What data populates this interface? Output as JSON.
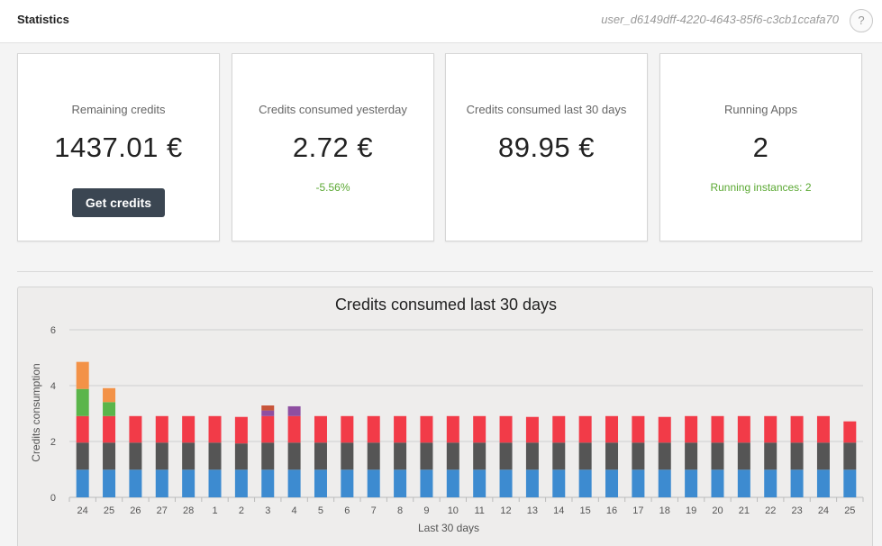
{
  "header": {
    "title": "Statistics",
    "user_id": "user_d6149dff-4220-4643-85f6-c3cb1ccafa70",
    "help_label": "?"
  },
  "cards": [
    {
      "label": "Remaining credits",
      "value": "1437.01 €",
      "button_label": "Get credits"
    },
    {
      "label": "Credits consumed yesterday",
      "value": "2.72 €",
      "sub": "-5.56%"
    },
    {
      "label": "Credits consumed last 30 days",
      "value": "89.95 €"
    },
    {
      "label": "Running Apps",
      "value": "2",
      "sub": "Running instances: 2"
    }
  ],
  "colors": {
    "accent_dark": "#3b4652",
    "positive": "#5aa832",
    "blue": "#3d8bd0",
    "gray": "#555555",
    "red": "#f23b48",
    "green": "#5ab54a",
    "orange": "#f39247",
    "purple": "#8e4fa1",
    "brown": "#c8553a"
  },
  "chart_data": {
    "type": "bar",
    "stacked": true,
    "title": "Credits consumed last 30 days",
    "xlabel": "Last 30 days",
    "ylabel": "Credits consumption",
    "ylim": [
      0,
      6
    ],
    "yticks": [
      0,
      2,
      4,
      6
    ],
    "grid": true,
    "categories": [
      "24",
      "25",
      "26",
      "27",
      "28",
      "1",
      "2",
      "3",
      "4",
      "5",
      "6",
      "7",
      "8",
      "9",
      "10",
      "11",
      "12",
      "13",
      "14",
      "15",
      "16",
      "17",
      "18",
      "19",
      "20",
      "21",
      "22",
      "23",
      "24",
      "25"
    ],
    "series": [
      {
        "color": "#3d8bd0",
        "values": [
          0.99,
          0.99,
          0.99,
          0.99,
          0.99,
          0.99,
          0.99,
          0.99,
          0.99,
          0.99,
          0.99,
          0.99,
          0.99,
          0.99,
          0.99,
          0.99,
          0.99,
          0.99,
          0.99,
          0.99,
          0.99,
          0.99,
          0.99,
          0.99,
          0.99,
          0.99,
          0.99,
          0.99,
          0.99,
          0.99
        ]
      },
      {
        "color": "#555555",
        "values": [
          0.97,
          0.97,
          0.97,
          0.97,
          0.97,
          0.97,
          0.94,
          0.97,
          0.97,
          0.97,
          0.97,
          0.97,
          0.97,
          0.97,
          0.97,
          0.97,
          0.97,
          0.97,
          0.97,
          0.97,
          0.97,
          0.97,
          0.97,
          0.97,
          0.97,
          0.97,
          0.97,
          0.97,
          0.97,
          0.97
        ]
      },
      {
        "color": "#f23b48",
        "values": [
          0.95,
          0.95,
          0.95,
          0.95,
          0.95,
          0.95,
          0.95,
          0.95,
          0.95,
          0.95,
          0.95,
          0.95,
          0.95,
          0.95,
          0.95,
          0.95,
          0.95,
          0.92,
          0.95,
          0.95,
          0.95,
          0.95,
          0.92,
          0.95,
          0.95,
          0.95,
          0.95,
          0.95,
          0.95,
          0.76
        ]
      },
      {
        "color": "#5ab54a",
        "values": [
          0.97,
          0.5,
          0,
          0,
          0,
          0,
          0,
          0,
          0,
          0,
          0,
          0,
          0,
          0,
          0,
          0,
          0,
          0,
          0,
          0,
          0,
          0,
          0,
          0,
          0,
          0,
          0,
          0,
          0,
          0
        ]
      },
      {
        "color": "#f39247",
        "values": [
          0.97,
          0.5,
          0,
          0,
          0,
          0,
          0,
          0,
          0,
          0,
          0,
          0,
          0,
          0,
          0,
          0,
          0,
          0,
          0,
          0,
          0,
          0,
          0,
          0,
          0,
          0,
          0,
          0,
          0,
          0
        ]
      },
      {
        "color": "#8e4fa1",
        "values": [
          0,
          0,
          0,
          0,
          0,
          0,
          0,
          0.2,
          0.35,
          0,
          0,
          0,
          0,
          0,
          0,
          0,
          0,
          0,
          0,
          0,
          0,
          0,
          0,
          0,
          0,
          0,
          0,
          0,
          0,
          0
        ]
      },
      {
        "color": "#c8553a",
        "values": [
          0,
          0,
          0,
          0,
          0,
          0,
          0,
          0.18,
          0,
          0,
          0,
          0,
          0,
          0,
          0,
          0,
          0,
          0,
          0,
          0,
          0,
          0,
          0,
          0,
          0,
          0,
          0,
          0,
          0,
          0
        ]
      }
    ]
  }
}
